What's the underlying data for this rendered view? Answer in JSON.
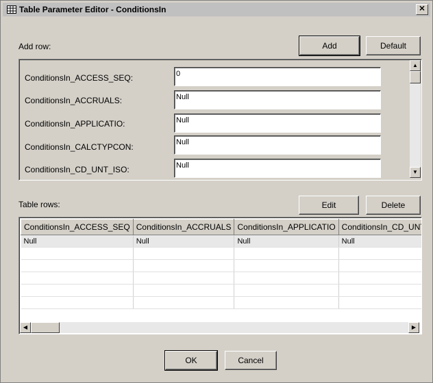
{
  "window": {
    "title": "Table Parameter Editor - ConditionsIn",
    "close_glyph": "✕"
  },
  "add_row": {
    "label": "Add row:",
    "add_label": "Add",
    "default_label": "Default",
    "fields": [
      {
        "label": "ConditionsIn_ACCESS_SEQ:",
        "value": "0"
      },
      {
        "label": "ConditionsIn_ACCRUALS:",
        "value": "Null"
      },
      {
        "label": "ConditionsIn_APPLICATIO:",
        "value": "Null"
      },
      {
        "label": "ConditionsIn_CALCTYPCON:",
        "value": "Null"
      },
      {
        "label": "ConditionsIn_CD_UNT_ISO:",
        "value": "Null"
      }
    ]
  },
  "table_rows": {
    "label": "Table rows:",
    "edit_label": "Edit",
    "delete_label": "Delete",
    "columns": [
      "ConditionsIn_ACCESS_SEQ",
      "ConditionsIn_ACCRUALS",
      "ConditionsIn_APPLICATIO",
      "ConditionsIn_CD_UNT_ISO"
    ],
    "rows": [
      [
        "Null",
        "Null",
        "Null",
        "Null"
      ]
    ]
  },
  "footer": {
    "ok_label": "OK",
    "cancel_label": "Cancel"
  }
}
